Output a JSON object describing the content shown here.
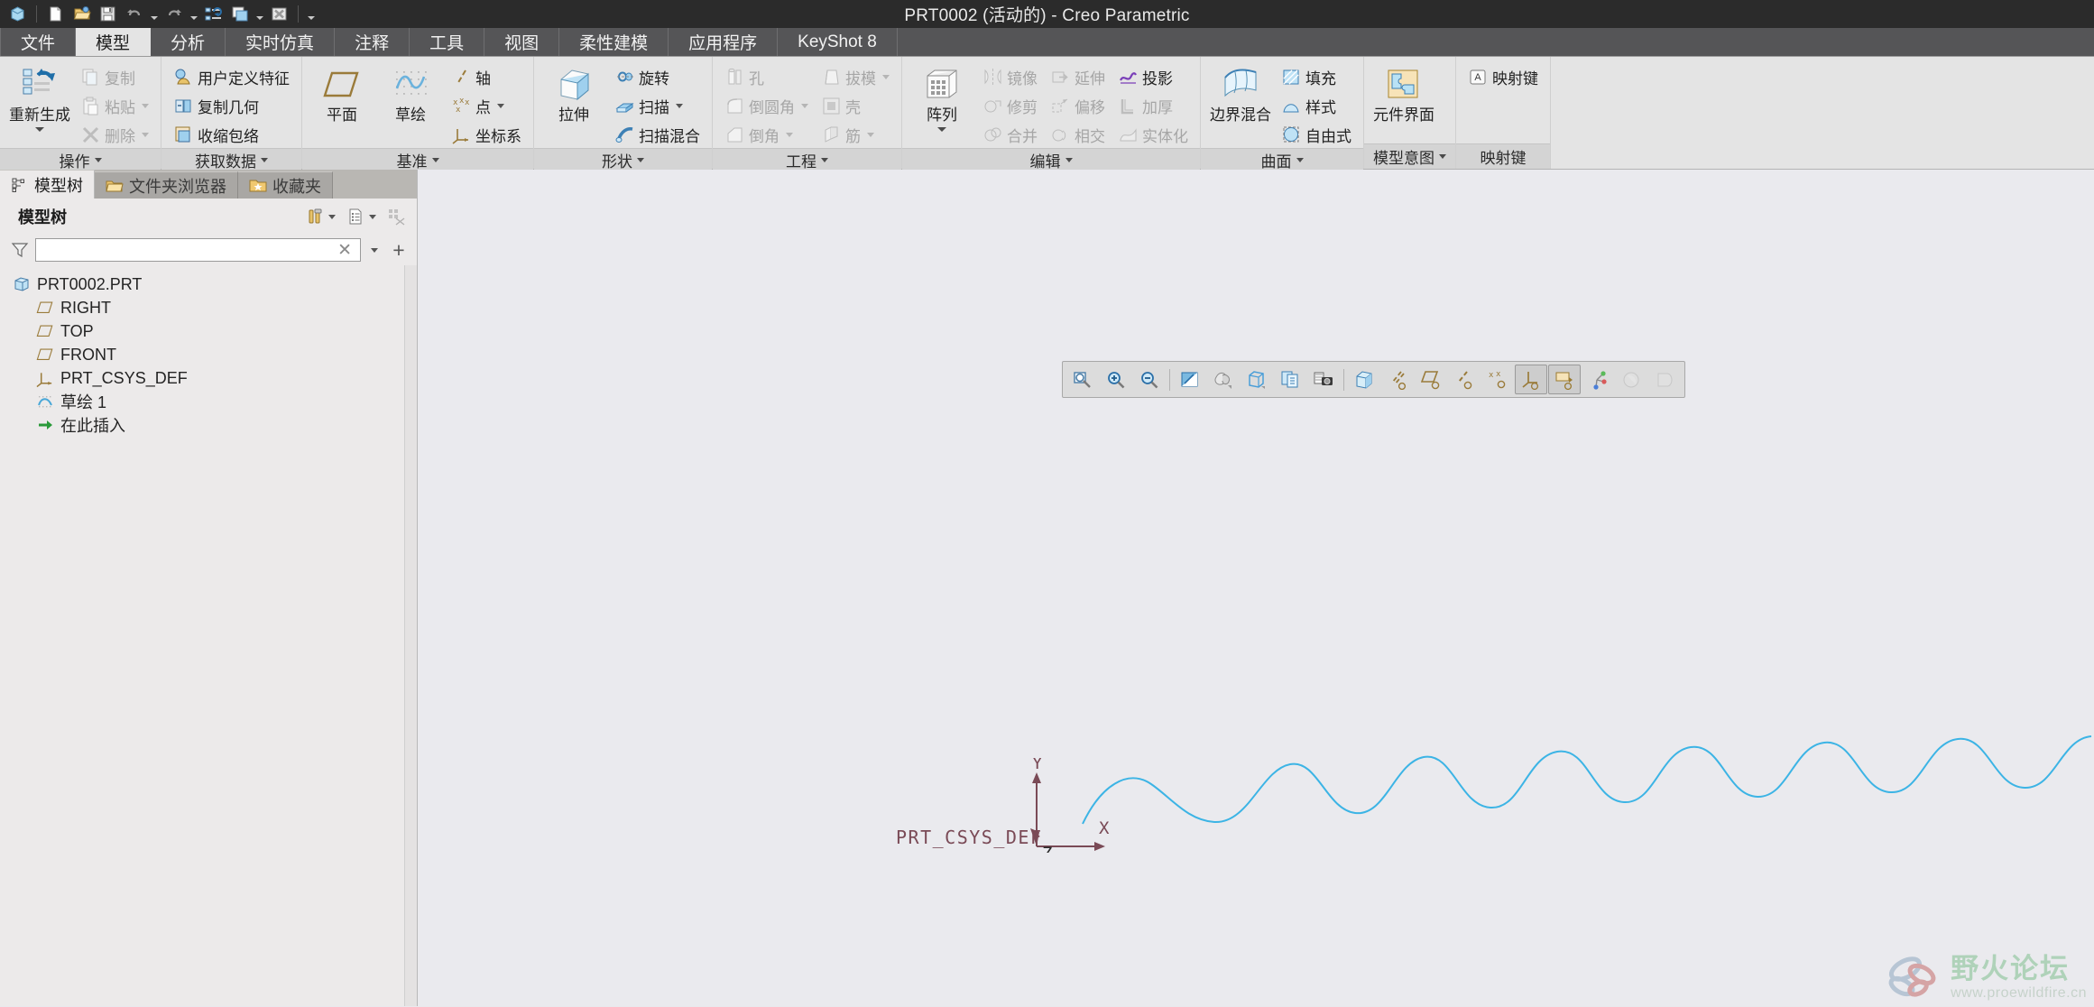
{
  "window": {
    "title": "PRT0002 (活动的) - Creo Parametric"
  },
  "quick_access": {
    "items": [
      {
        "name": "app-logo-icon",
        "label": "Creo"
      },
      {
        "name": "new-file-icon",
        "label": "新建"
      },
      {
        "name": "open-file-icon",
        "label": "打开"
      },
      {
        "name": "save-icon",
        "label": "保存"
      },
      {
        "name": "undo-icon",
        "label": "撤销"
      },
      {
        "name": "redo-icon",
        "label": "重做"
      },
      {
        "name": "regenerate-icon",
        "label": "重新生成"
      },
      {
        "name": "window-switch-icon",
        "label": "窗口"
      },
      {
        "name": "close-window-icon",
        "label": "关闭"
      },
      {
        "name": "customize-qat-icon",
        "label": "自定义快速访问工具栏"
      }
    ]
  },
  "ribbon": {
    "tabs": [
      {
        "label": "文件",
        "active": false
      },
      {
        "label": "模型",
        "active": true
      },
      {
        "label": "分析",
        "active": false
      },
      {
        "label": "实时仿真",
        "active": false
      },
      {
        "label": "注释",
        "active": false
      },
      {
        "label": "工具",
        "active": false
      },
      {
        "label": "视图",
        "active": false
      },
      {
        "label": "柔性建模",
        "active": false
      },
      {
        "label": "应用程序",
        "active": false
      },
      {
        "label": "KeyShot 8",
        "active": false
      }
    ],
    "groups": [
      {
        "title": "操作",
        "big": [
          {
            "label": "重新生成",
            "icon": "regenerate-icon",
            "disabled": false,
            "dropdown": true
          }
        ],
        "small": [
          {
            "label": "复制",
            "icon": "copy-icon",
            "disabled": true,
            "dropdown": false
          },
          {
            "label": "粘贴",
            "icon": "paste-icon",
            "disabled": true,
            "dropdown": true
          },
          {
            "label": "删除",
            "icon": "delete-icon",
            "disabled": true,
            "dropdown": true
          }
        ]
      },
      {
        "title": "获取数据",
        "big": [],
        "small": [
          {
            "label": "用户定义特征",
            "icon": "udf-icon",
            "disabled": false,
            "dropdown": false
          },
          {
            "label": "复制几何",
            "icon": "copy-geometry-icon",
            "disabled": false,
            "dropdown": false
          },
          {
            "label": "收缩包络",
            "icon": "shrinkwrap-icon",
            "disabled": false,
            "dropdown": false
          }
        ]
      },
      {
        "title": "基准",
        "big": [
          {
            "label": "平面",
            "icon": "datum-plane-icon",
            "disabled": false,
            "dropdown": false
          },
          {
            "label": "草绘",
            "icon": "sketch-icon",
            "disabled": false,
            "dropdown": false
          }
        ],
        "small": [
          {
            "label": "轴",
            "icon": "datum-axis-icon",
            "disabled": false,
            "dropdown": false
          },
          {
            "label": "点",
            "icon": "datum-point-icon",
            "disabled": false,
            "dropdown": true
          },
          {
            "label": "坐标系",
            "icon": "coordinate-system-icon",
            "disabled": false,
            "dropdown": false
          }
        ]
      },
      {
        "title": "形状",
        "big": [
          {
            "label": "拉伸",
            "icon": "extrude-icon",
            "disabled": false,
            "dropdown": false
          }
        ],
        "small": [
          {
            "label": "旋转",
            "icon": "revolve-icon",
            "disabled": false,
            "dropdown": false
          },
          {
            "label": "扫描",
            "icon": "sweep-icon",
            "disabled": false,
            "dropdown": true
          },
          {
            "label": "扫描混合",
            "icon": "swept-blend-icon",
            "disabled": false,
            "dropdown": false
          }
        ]
      },
      {
        "title": "工程",
        "big": [],
        "small": [
          {
            "label": "孔",
            "icon": "hole-icon",
            "disabled": true,
            "dropdown": false
          },
          {
            "label": "倒圆角",
            "icon": "round-icon",
            "disabled": true,
            "dropdown": true
          },
          {
            "label": "倒角",
            "icon": "chamfer-icon",
            "disabled": true,
            "dropdown": true
          },
          {
            "label": "拔模",
            "icon": "draft-icon",
            "disabled": true,
            "dropdown": true
          },
          {
            "label": "壳",
            "icon": "shell-icon",
            "disabled": true,
            "dropdown": false
          },
          {
            "label": "筋",
            "icon": "rib-icon",
            "disabled": true,
            "dropdown": true
          }
        ]
      },
      {
        "title": "编辑",
        "big": [
          {
            "label": "阵列",
            "icon": "pattern-icon",
            "disabled": false,
            "dropdown": true
          }
        ],
        "small": [
          {
            "label": "镜像",
            "icon": "mirror-icon",
            "disabled": true,
            "dropdown": false
          },
          {
            "label": "修剪",
            "icon": "trim-icon",
            "disabled": true,
            "dropdown": false
          },
          {
            "label": "合并",
            "icon": "merge-icon",
            "disabled": true,
            "dropdown": false
          },
          {
            "label": "延伸",
            "icon": "extend-icon",
            "disabled": true,
            "dropdown": false
          },
          {
            "label": "偏移",
            "icon": "offset-icon",
            "disabled": true,
            "dropdown": false
          },
          {
            "label": "相交",
            "icon": "intersect-icon",
            "disabled": true,
            "dropdown": false
          },
          {
            "label": "投影",
            "icon": "project-icon",
            "disabled": false,
            "dropdown": false
          },
          {
            "label": "加厚",
            "icon": "thicken-icon",
            "disabled": true,
            "dropdown": false
          },
          {
            "label": "实体化",
            "icon": "solidify-icon",
            "disabled": true,
            "dropdown": false
          }
        ]
      },
      {
        "title": "曲面",
        "big": [
          {
            "label": "边界混合",
            "icon": "boundary-blend-icon",
            "disabled": false,
            "dropdown": false
          }
        ],
        "small": [
          {
            "label": "填充",
            "icon": "fill-icon",
            "disabled": false,
            "dropdown": false
          },
          {
            "label": "样式",
            "icon": "style-icon",
            "disabled": false,
            "dropdown": false
          },
          {
            "label": "自由式",
            "icon": "freestyle-icon",
            "disabled": false,
            "dropdown": false
          }
        ]
      },
      {
        "title": "模型意图",
        "big": [
          {
            "label": "元件界面",
            "icon": "component-interface-icon",
            "disabled": false,
            "dropdown": false
          }
        ],
        "small": []
      },
      {
        "title": "映射键",
        "big": [],
        "small": [
          {
            "label": "映射键",
            "icon": "mapkey-icon",
            "disabled": false,
            "dropdown": false
          }
        ]
      }
    ]
  },
  "navigator": {
    "tabs": [
      {
        "label": "模型树",
        "icon": "model-tree-icon",
        "active": true
      },
      {
        "label": "文件夹浏览器",
        "icon": "folder-browser-icon",
        "active": false
      },
      {
        "label": "收藏夹",
        "icon": "favorites-icon",
        "active": false
      }
    ],
    "header": {
      "title": "模型树",
      "buttons": [
        {
          "name": "tree-settings-icon",
          "label": "设置",
          "dropdown": true
        },
        {
          "name": "tree-display-icon",
          "label": "显示",
          "dropdown": true
        },
        {
          "name": "tree-filter-off-icon",
          "label": "过滤器",
          "dropdown": false
        }
      ]
    },
    "filter": {
      "icon": "funnel-icon",
      "value": "",
      "placeholder": "",
      "clear_icon": "clear-icon",
      "dropdown_icon": "chevron-down-icon",
      "add_icon": "plus-icon"
    },
    "tree_items": [
      {
        "label": "PRT0002.PRT",
        "icon": "part-icon",
        "indent": 0
      },
      {
        "label": "RIGHT",
        "icon": "datum-plane-icon",
        "indent": 1
      },
      {
        "label": "TOP",
        "icon": "datum-plane-icon",
        "indent": 1
      },
      {
        "label": "FRONT",
        "icon": "datum-plane-icon",
        "indent": 1
      },
      {
        "label": "PRT_CSYS_DEF",
        "icon": "coordinate-system-icon",
        "indent": 1
      },
      {
        "label": "草绘 1",
        "icon": "sketch-feature-icon",
        "indent": 1
      },
      {
        "label": "在此插入",
        "icon": "insert-here-icon",
        "indent": 1
      }
    ]
  },
  "graphics": {
    "toolbar": [
      {
        "name": "refit-icon",
        "label": "重新调整",
        "state": "normal"
      },
      {
        "name": "zoom-in-icon",
        "label": "放大",
        "state": "normal"
      },
      {
        "name": "zoom-out-icon",
        "label": "缩小",
        "state": "normal"
      },
      {
        "name": "repaint-icon",
        "label": "重画",
        "state": "normal"
      },
      {
        "name": "display-style-icon",
        "label": "显示样式",
        "state": "normal"
      },
      {
        "name": "saved-orientations-icon",
        "label": "已保存方向",
        "state": "normal"
      },
      {
        "name": "view-manager-icon",
        "label": "视图管理器",
        "state": "normal"
      },
      {
        "name": "capture-image-icon",
        "label": "捕获图像",
        "state": "normal"
      },
      {
        "name": "perspective-icon",
        "label": "透视图",
        "state": "normal"
      },
      {
        "name": "datum-display-axis-icon",
        "label": "基准轴显示",
        "state": "normal"
      },
      {
        "name": "datum-display-plane-icon",
        "label": "基准平面显示",
        "state": "normal"
      },
      {
        "name": "datum-display-axis2-icon",
        "label": "轴显示",
        "state": "normal"
      },
      {
        "name": "datum-display-point-icon",
        "label": "基准点显示",
        "state": "normal"
      },
      {
        "name": "datum-display-csys-icon",
        "label": "坐标系显示",
        "state": "on"
      },
      {
        "name": "annotation-display-icon",
        "label": "注释显示",
        "state": "on"
      },
      {
        "name": "spin-center-icon",
        "label": "旋转中心",
        "state": "normal"
      },
      {
        "name": "appearance-icon",
        "label": "外观",
        "state": "disabled"
      },
      {
        "name": "layer-icon",
        "label": "层",
        "state": "disabled"
      }
    ],
    "csys": {
      "label": "PRT_CSYS_DEF",
      "axes": [
        {
          "name": "y-axis-label",
          "label": "Y"
        },
        {
          "name": "x-axis-label",
          "label": "X"
        },
        {
          "name": "z-axis-label",
          "label": "Z"
        }
      ],
      "color": "#7a4a56"
    },
    "curve": {
      "name": "sine-wave-sketch",
      "color": "#3cb4e5",
      "description": "正弦曲线草绘"
    },
    "background_color": "#eaeaee"
  },
  "watermark": {
    "name_cn": "野火论坛",
    "url": "www.proewildfire.cn"
  }
}
